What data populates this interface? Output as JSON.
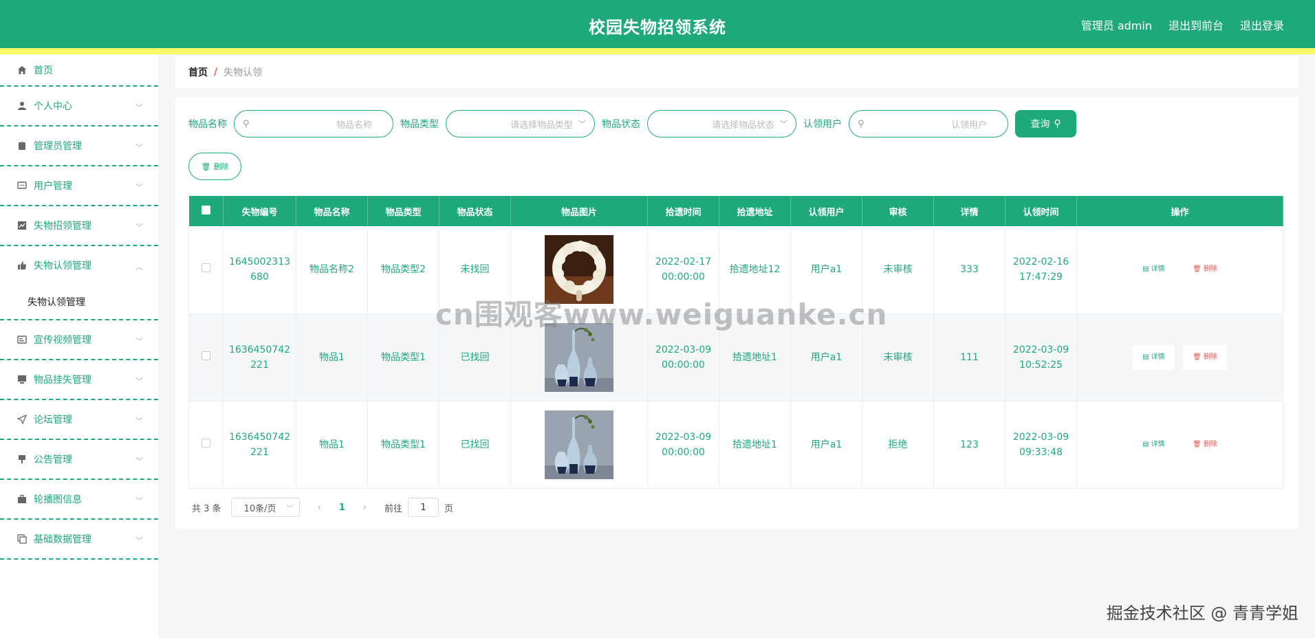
{
  "header": {
    "title": "校园失物招领系统",
    "admin": "管理员 admin",
    "front": "退出到前台",
    "logout": "退出登录"
  },
  "sidebar": {
    "items": [
      {
        "label": "首页",
        "icon": "home-icon"
      },
      {
        "label": "个人中心",
        "icon": "user-icon"
      },
      {
        "label": "管理员管理",
        "icon": "clipboard-icon"
      },
      {
        "label": "用户管理",
        "icon": "chat-icon"
      },
      {
        "label": "失物招领管理",
        "icon": "chart-icon"
      },
      {
        "label": "失物认领管理",
        "icon": "thumb-icon",
        "sub": "失物认领管理"
      },
      {
        "label": "宣传视频管理",
        "icon": "card-icon"
      },
      {
        "label": "物品挂失管理",
        "icon": "monitor-icon"
      },
      {
        "label": "论坛管理",
        "icon": "send-icon"
      },
      {
        "label": "公告管理",
        "icon": "pin-icon"
      },
      {
        "label": "轮播图信息",
        "icon": "briefcase-icon"
      },
      {
        "label": "基础数据管理",
        "icon": "copy-icon"
      }
    ]
  },
  "breadcrumb": {
    "home": "首页",
    "sep": "/",
    "current": "失物认领"
  },
  "search": {
    "name_label": "物品名称",
    "name_ph": "物品名称",
    "type_label": "物品类型",
    "type_ph": "请选择物品类型",
    "status_label": "物品状态",
    "status_ph": "请选择物品状态",
    "user_label": "认领用户",
    "user_ph": "认领用户",
    "query": "查询",
    "delete": "删除"
  },
  "table": {
    "headers": [
      "失物编号",
      "物品名称",
      "物品类型",
      "物品状态",
      "物品图片",
      "拾遗时间",
      "拾遗地址",
      "认领用户",
      "审核",
      "详情",
      "认领时间",
      "操作"
    ],
    "rows": [
      {
        "id1": "1645002313",
        "id2": "680",
        "name": "物品名称2",
        "type": "物品类型2",
        "status": "未找回",
        "time1": "2022-02-17",
        "time2": "00:00:00",
        "addr": "拾遗地址12",
        "user": "用户a1",
        "audit": "未审核",
        "detail": "333",
        "ctime1": "2022-02-16",
        "ctime2": "17:47:29",
        "img": "beads"
      },
      {
        "id1": "1636450742",
        "id2": "221",
        "name": "物品1",
        "type": "物品类型1",
        "status": "已找回",
        "time1": "2022-03-09",
        "time2": "00:00:00",
        "addr": "拾遗地址1",
        "user": "用户a1",
        "audit": "未审核",
        "detail": "111",
        "ctime1": "2022-03-09",
        "ctime2": "10:52:25",
        "img": "vase"
      },
      {
        "id1": "1636450742",
        "id2": "221",
        "name": "物品1",
        "type": "物品类型1",
        "status": "已找回",
        "time1": "2022-03-09",
        "time2": "00:00:00",
        "addr": "拾遗地址1",
        "user": "用户a1",
        "audit": "拒绝",
        "detail": "123",
        "ctime1": "2022-03-09",
        "ctime2": "09:33:48",
        "img": "vase"
      }
    ],
    "action_detail": "详情",
    "action_delete": "删除"
  },
  "pager": {
    "total": "共 3 条",
    "size": "10条/页",
    "page": "1",
    "goto": "前往",
    "goto_val": "1",
    "page_unit": "页"
  },
  "watermark": {
    "center": "cn围观客www.weiguanke.cn",
    "corner": "掘金技术社区 @ 青青学姐"
  },
  "colors": {
    "primary": "#1daa78",
    "stripe": "#f7fb67",
    "danger": "#e05c5c"
  }
}
